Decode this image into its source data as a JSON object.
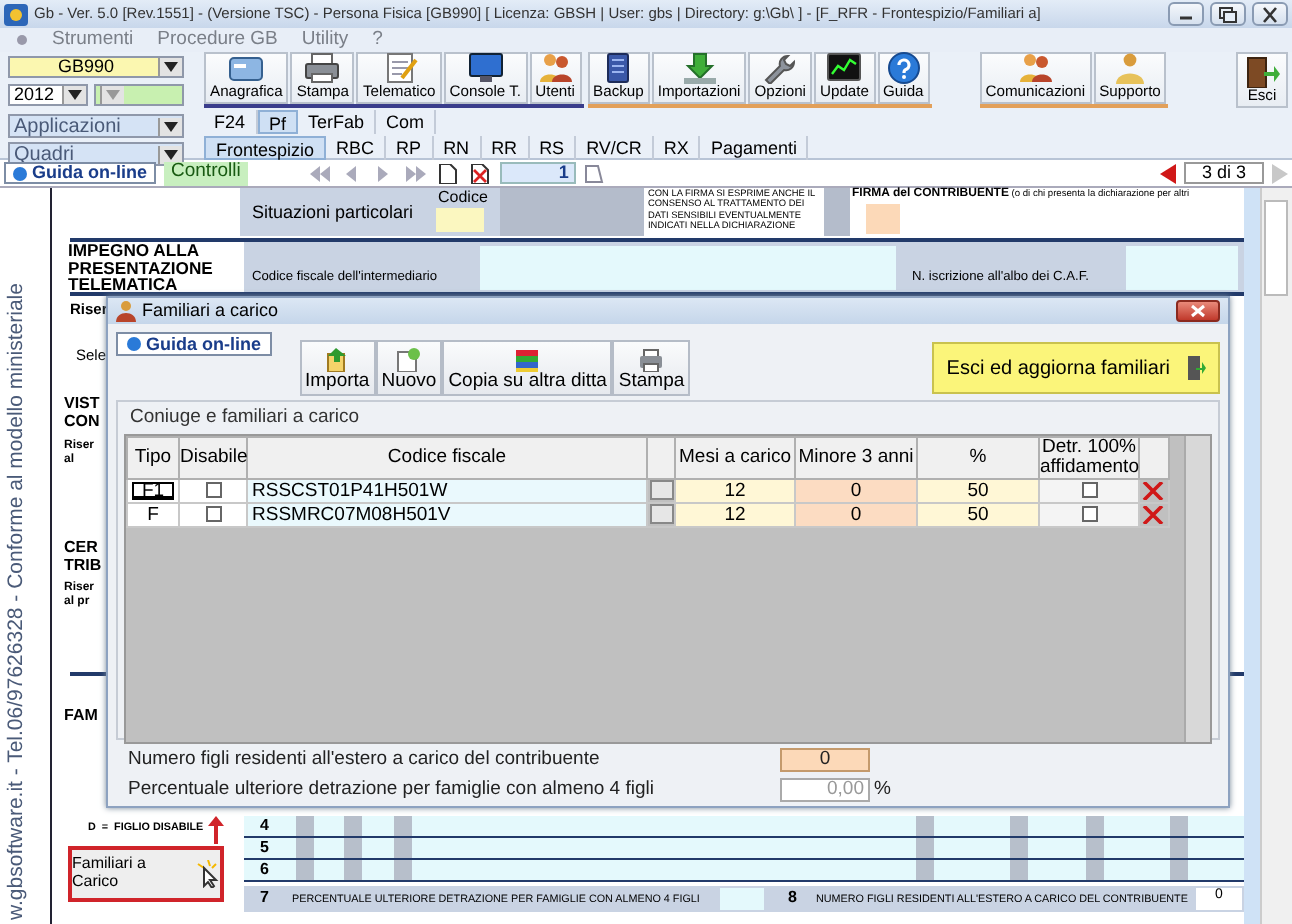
{
  "window": {
    "title": "Gb - Ver. 5.0 [Rev.1551] - (Versione TSC) -  Persona Fisica [GB990]     [ Licenza: GBSH | User: gbs | Directory: g:\\Gb\\ ] - [F_RFR - Frontespizio/Familiari a]"
  },
  "menu": [
    "Strumenti",
    "Procedure GB",
    "Utility",
    "?"
  ],
  "selectors": {
    "company": "GB990",
    "year": "2012",
    "applications": "Applicazioni",
    "sections": "Quadri"
  },
  "toolbar": [
    {
      "label": "Anagrafica"
    },
    {
      "label": "Stampa"
    },
    {
      "label": "Telematico"
    },
    {
      "label": "Console T."
    },
    {
      "label": "Utenti"
    },
    {
      "label": "Backup"
    },
    {
      "label": "Importazioni"
    },
    {
      "label": "Opzioni"
    },
    {
      "label": "Update"
    },
    {
      "label": "Guida"
    }
  ],
  "toolbar_right": [
    "Comunicazioni",
    "Supporto"
  ],
  "exit": "Esci",
  "module_tabs": [
    {
      "label": "F24",
      "selected": false
    },
    {
      "label": "Pf",
      "selected": true
    },
    {
      "label": "TerFab",
      "selected": false
    },
    {
      "label": "Com",
      "selected": false
    }
  ],
  "section_tabs": [
    {
      "label": "Frontespizio",
      "selected": true
    },
    {
      "label": "RBC",
      "selected": false
    },
    {
      "label": "RP",
      "selected": false
    },
    {
      "label": "RN",
      "selected": false
    },
    {
      "label": "RR",
      "selected": false
    },
    {
      "label": "RS",
      "selected": false
    },
    {
      "label": "RV/CR",
      "selected": false
    },
    {
      "label": "RX",
      "selected": false
    },
    {
      "label": "Pagamenti",
      "selected": false
    }
  ],
  "navigator": {
    "help": "Guida on-line",
    "checks": "Controlli",
    "page": "1",
    "counter": "3 di 3"
  },
  "form": {
    "side_text": "w.gbsoftware.it - Tel.06/97626328 - Conforme al modello ministeriale",
    "situations": "Situazioni particolari",
    "code_label": "Codice",
    "consent": "CON LA FIRMA SI ESPRIME ANCHE IL CONSENSO AL TRATTAMENTO DEI DATI SENSIBILI EVENTUALMENTE INDICATI NELLA DICHIARAZIONE",
    "signature": "FIRMA del CONTRIBUENTE",
    "signature_note": "(o di chi presenta la dichiarazione per altri",
    "commitment": "IMPEGNO ALLA PRESENTAZIONE TELEMATICA",
    "commitment_note": "Riser",
    "intermediary": "Codice fiscale dell'intermediario",
    "caf": "N. iscrizione all'albo dei C.A.F.",
    "select": "Sele",
    "visa": [
      "VIST",
      "CON"
    ],
    "visa_note": [
      "Riser",
      "al"
    ],
    "cert": [
      "CER",
      "TRIB"
    ],
    "cert_note": [
      "Riser",
      "al pr"
    ],
    "family": "FAM",
    "disabled_legend": "D  =  FIGLIO DISABILE",
    "rows": [
      "4",
      "5",
      "6"
    ],
    "row7_num": "7",
    "row7": "PERCENTUALE ULTERIORE DETRAZIONE PER FAMIGLIE CON ALMENO 4 FIGLI",
    "row8_num": "8",
    "row8": "NUMERO FIGLI RESIDENTI ALL'ESTERO A CARICO DEL CONTRIBUENTE",
    "row8_value": "0",
    "family_button": "Familiari a Carico"
  },
  "dialog": {
    "title": "Familiari a carico",
    "help": "Guida on-line",
    "buttons": [
      "Importa",
      "Nuovo",
      "Copia su altra ditta",
      "Stampa"
    ],
    "exit": "Esci ed aggiorna familiari",
    "group": "Coniuge e familiari a carico",
    "columns": [
      "Tipo",
      "Disabile",
      "Codice fiscale",
      "Mesi a carico",
      "Minore 3 anni",
      "%",
      "Detr. 100% affidamento"
    ],
    "rows": [
      {
        "type": "F1",
        "selected": true,
        "disabled": false,
        "tax_code": "RSSCST01P41H501W",
        "months": "12",
        "under_3": "0",
        "percent": "50",
        "foster": false
      },
      {
        "type": "F",
        "selected": false,
        "disabled": false,
        "tax_code": "RSSMRC07M08H501V",
        "months": "12",
        "under_3": "0",
        "percent": "50",
        "foster": false
      }
    ],
    "foreign_children_label": "Numero figli residenti all'estero a carico del contribuente",
    "foreign_children": "0",
    "extra_label": "Percentuale ulteriore detrazione per famiglie con almeno 4 figli",
    "extra": "0,00",
    "extra_unit": "%"
  }
}
